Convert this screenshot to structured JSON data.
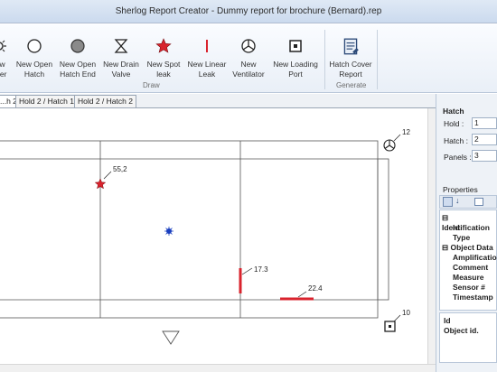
{
  "window": {
    "title": "Sherlog Report Creator - Dummy report for brochure (Bernard).rep"
  },
  "ribbon": {
    "buttons": [
      {
        "label": "...w\n...ter",
        "icon": "gear-icon"
      },
      {
        "label": "New Open\nHatch",
        "icon": "open-circle-icon"
      },
      {
        "label": "New Open\nHatch End",
        "icon": "filled-circle-icon"
      },
      {
        "label": "New Drain\nValve",
        "icon": "hourglass-icon"
      },
      {
        "label": "New Spot\nleak",
        "icon": "star-icon"
      },
      {
        "label": "New Linear\nLeak",
        "icon": "linear-leak-icon"
      },
      {
        "label": "New\nVentilator",
        "icon": "ventilator-icon"
      },
      {
        "label": "New Loading\nPort",
        "icon": "loading-port-icon"
      },
      {
        "label": "Hatch Cover\nReport",
        "icon": "report-icon"
      }
    ],
    "groups": {
      "draw": "Draw",
      "generate": "Generate"
    }
  },
  "tabs": [
    "...h 2",
    "Hold 2 / Hatch 1",
    "Hold 2 / Hatch 2"
  ],
  "canvas": {
    "labels": {
      "corner_tr": "12",
      "corner_br": "10",
      "star": "55,2",
      "linear_v": "17.3",
      "linear_h": "22.4"
    }
  },
  "hatch_panel": {
    "title": "Hatch",
    "hold_label": "Hold :",
    "hold_value": "1",
    "hatch_label": "Hatch :",
    "hatch_value": "2",
    "panels_label": "Panels :",
    "panels_value": "3"
  },
  "properties": {
    "title": "Properties",
    "rows": [
      "Identification",
      "Id",
      "Type",
      "Object Data",
      "Amplification",
      "Comment",
      "Measure",
      "Sensor #",
      "Timestamp"
    ]
  },
  "description": {
    "title": "Id",
    "text": "Object id."
  },
  "colors": {
    "accent": "#d9232d",
    "marker": "#1a3fbf",
    "ribbon": "#e9eff7"
  }
}
